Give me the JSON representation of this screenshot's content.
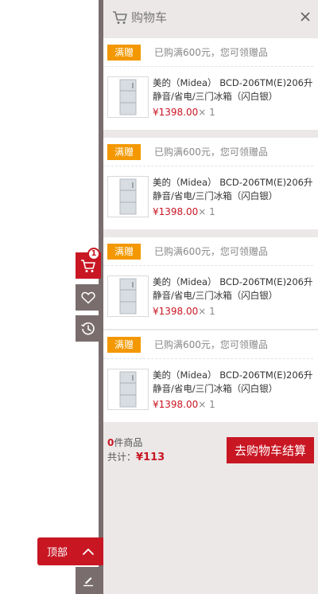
{
  "toolbar": {
    "cart_badge": "1",
    "top_label": "顶部"
  },
  "panel": {
    "title": "购物车",
    "items": [
      {
        "tag": "满赠",
        "promo": "已购满600元，您可领赠品",
        "name": "美的（Midea） BCD-206TM(E)206升静音/省电/三门冰箱（闪白银）",
        "price": "¥1398.00",
        "qty": "× 1"
      },
      {
        "tag": "满赠",
        "promo": "已购满600元，您可领赠品",
        "name": "美的（Midea） BCD-206TM(E)206升静音/省电/三门冰箱（闪白银）",
        "price": "¥1398.00",
        "qty": "× 1"
      },
      {
        "tag": "满赠",
        "promo": "已购满600元，您可领赠品",
        "name": "美的（Midea） BCD-206TM(E)206升静音/省电/三门冰箱（闪白银）",
        "price": "¥1398.00",
        "qty": "× 1"
      },
      {
        "tag": "满赠",
        "promo": "已购满600元，您可领赠品",
        "name": "美的（Midea） BCD-206TM(E)206升静音/省电/三门冰箱（闪白银）",
        "price": "¥1398.00",
        "qty": "× 1"
      }
    ],
    "summary": {
      "count": "0",
      "count_suffix": "件商品",
      "total_label": "共计：",
      "total_value": "¥113",
      "checkout_label": "去购物车结算"
    }
  },
  "colors": {
    "brand_red": "#c81623",
    "tag_orange": "#f39800",
    "toolbar_gray": "#7a6d6d",
    "panel_bg": "#ece8e8"
  },
  "icons": [
    "cart-icon",
    "heart-icon",
    "history-icon",
    "chevron-up-icon",
    "edit-icon",
    "close-icon",
    "fridge-thumbnail"
  ]
}
